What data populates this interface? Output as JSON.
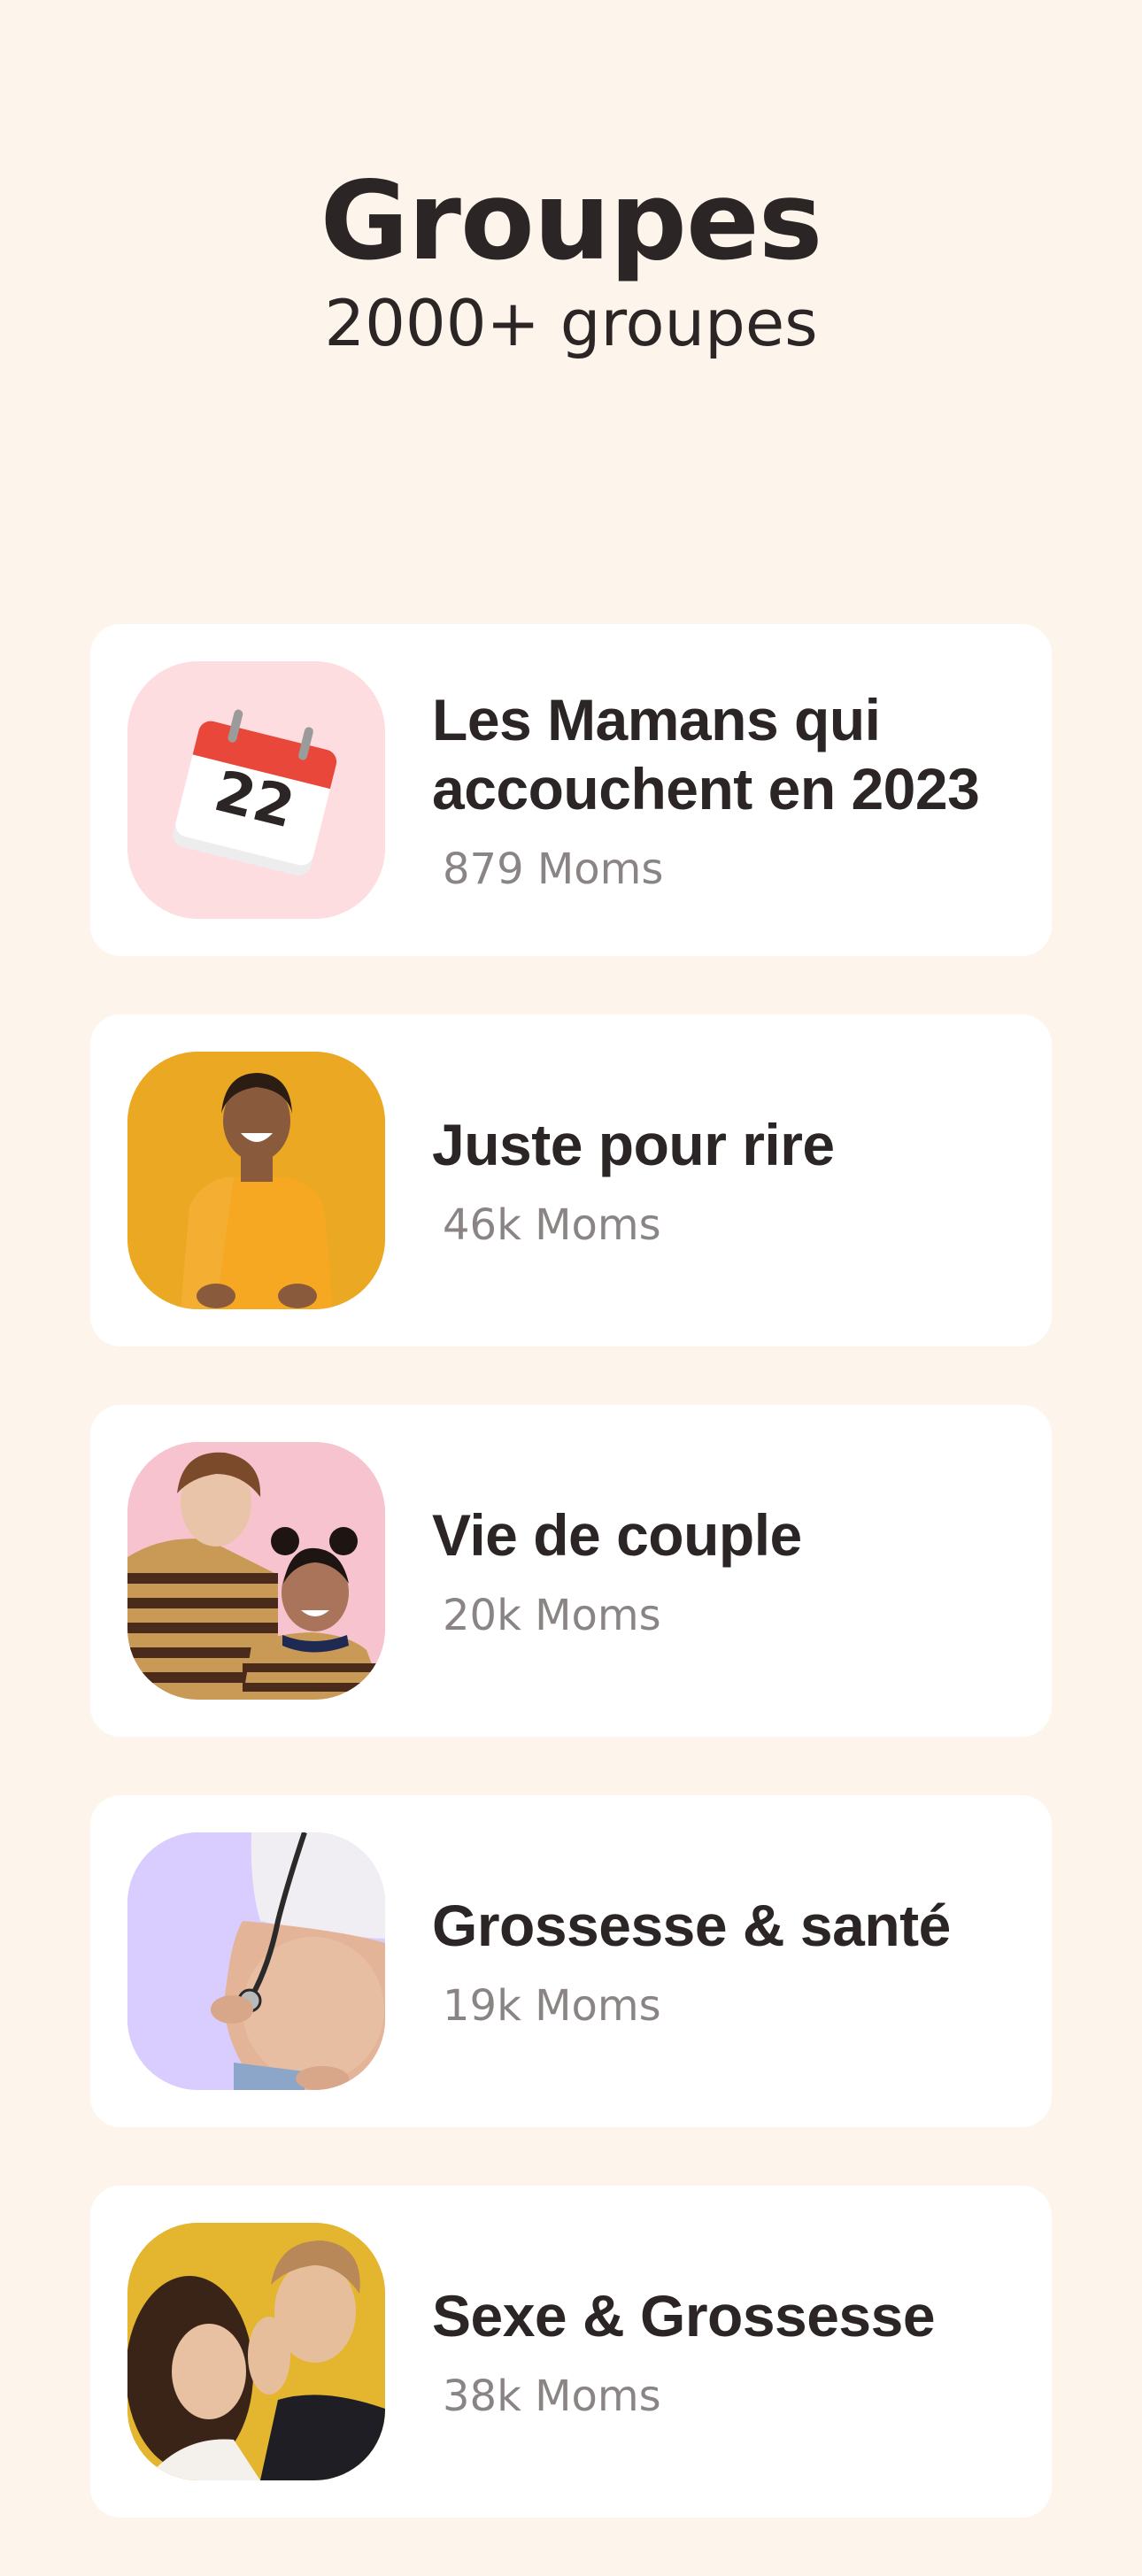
{
  "header": {
    "title": "Groupes",
    "subtitle": "2000+ groupes"
  },
  "groups": [
    {
      "name": "Les Mamans qui accouchent en 2023",
      "count": "879 Moms",
      "thumb_bg": "#FDDDE0",
      "thumb_icon": "calendar-icon",
      "calendar_number": "22"
    },
    {
      "name": "Juste pour rire",
      "count": "46k Moms",
      "thumb_bg": "#EBA823",
      "thumb_icon": "woman-laughing-photo"
    },
    {
      "name": "Vie de couple",
      "count": "20k Moms",
      "thumb_bg": "#F6C3CF",
      "thumb_icon": "couple-photo"
    },
    {
      "name": "Grossesse & santé",
      "count": "19k Moms",
      "thumb_bg": "#D9CCFF",
      "thumb_icon": "pregnant-belly-photo"
    },
    {
      "name": "Sexe & Grossesse",
      "count": "38k Moms",
      "thumb_bg": "#E4B52E",
      "thumb_icon": "couple-whisper-photo"
    }
  ]
}
